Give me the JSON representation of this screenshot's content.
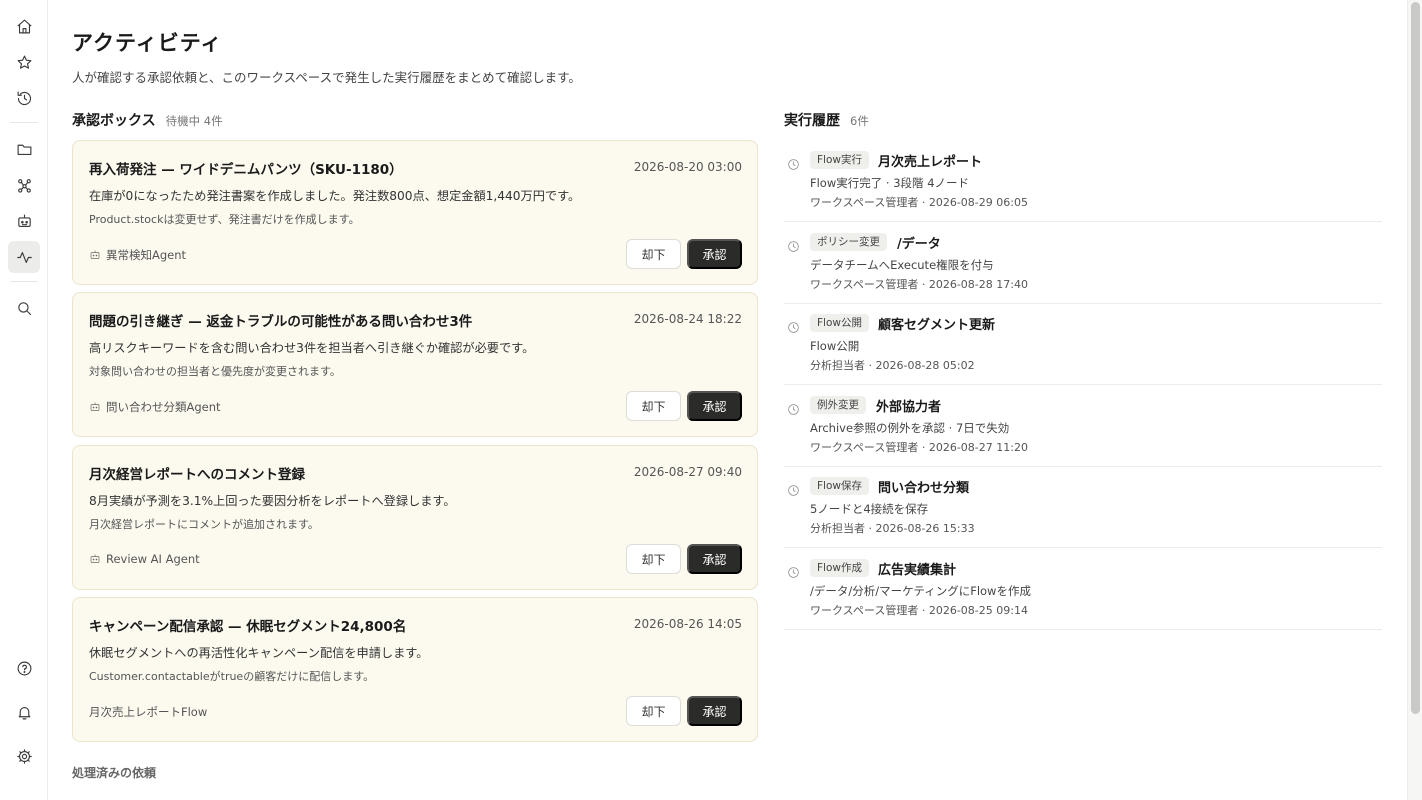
{
  "sidebar": {
    "items": [
      {
        "name": "home-icon"
      },
      {
        "name": "star-icon"
      },
      {
        "name": "history-icon"
      },
      {
        "name": "folder-icon"
      },
      {
        "name": "flow-icon"
      },
      {
        "name": "agent-icon"
      },
      {
        "name": "activity-icon"
      },
      {
        "name": "search-icon"
      },
      {
        "name": "help-icon"
      },
      {
        "name": "bell-icon"
      },
      {
        "name": "gear-icon"
      }
    ],
    "active": "activity-icon"
  },
  "page": {
    "title": "アクティビティ",
    "description": "人が確認する承認依頼と、このワークスペースで発生した実行履歴をまとめて確認します。"
  },
  "approvals": {
    "title": "承認ボックス",
    "meta": "待機中 4件",
    "items": [
      {
        "title": "再入荷発注 — ワイドデニムパンツ（SKU-1180）",
        "time": "2026-08-20 03:00",
        "desc": "在庫が0になったため発注書案を作成しました。発注数800点、想定金額1,440万円です。",
        "note": "Product.stockは変更せず、発注書だけを作成します。",
        "source": "異常検知Agent",
        "source_icon": "agent-icon",
        "reject": "却下",
        "approve": "承認"
      },
      {
        "title": "問題の引き継ぎ — 返金トラブルの可能性がある問い合わせ3件",
        "time": "2026-08-24 18:22",
        "desc": "高リスクキーワードを含む問い合わせ3件を担当者へ引き継ぐか確認が必要です。",
        "note": "対象問い合わせの担当者と優先度が変更されます。",
        "source": "問い合わせ分類Agent",
        "source_icon": "agent-icon",
        "reject": "却下",
        "approve": "承認"
      },
      {
        "title": "月次経営レポートへのコメント登録",
        "time": "2026-08-27 09:40",
        "desc": "8月実績が予測を3.1%上回った要因分析をレポートへ登録します。",
        "note": "月次経営レポートにコメントが追加されます。",
        "source": "Review AI Agent",
        "source_icon": "agent-icon",
        "reject": "却下",
        "approve": "承認"
      },
      {
        "title": "キャンペーン配信承認 — 休眠セグメント24,800名",
        "time": "2026-08-26 14:05",
        "desc": "休眠セグメントへの再活性化キャンペーン配信を申請します。",
        "note": "Customer.contactableがtrueの顧客だけに配信します。",
        "source": "月次売上レポートFlow",
        "source_icon": "",
        "reject": "却下",
        "approve": "承認"
      }
    ],
    "processed_label": "処理済みの依頼"
  },
  "history": {
    "title": "実行履歴",
    "meta": "6件",
    "items": [
      {
        "tag": "Flow実行",
        "title": "月次売上レポート",
        "detail": "Flow実行完了 · 3段階 4ノード",
        "meta": "ワークスペース管理者 · 2026-08-29 06:05"
      },
      {
        "tag": "ポリシー変更",
        "title": "/データ",
        "detail": "データチームへExecute権限を付与",
        "meta": "ワークスペース管理者 · 2026-08-28 17:40"
      },
      {
        "tag": "Flow公開",
        "title": "顧客セグメント更新",
        "detail": "Flow公開",
        "meta": "分析担当者 · 2026-08-28 05:02"
      },
      {
        "tag": "例外変更",
        "title": "外部協力者",
        "detail": "Archive参照の例外を承認 · 7日で失効",
        "meta": "ワークスペース管理者 · 2026-08-27 11:20"
      },
      {
        "tag": "Flow保存",
        "title": "問い合わせ分類",
        "detail": "5ノードと4接続を保存",
        "meta": "分析担当者 · 2026-08-26 15:33"
      },
      {
        "tag": "Flow作成",
        "title": "広告実績集計",
        "detail": "/データ/分析/マーケティングにFlowを作成",
        "meta": "ワークスペース管理者 · 2026-08-25 09:14"
      }
    ]
  }
}
